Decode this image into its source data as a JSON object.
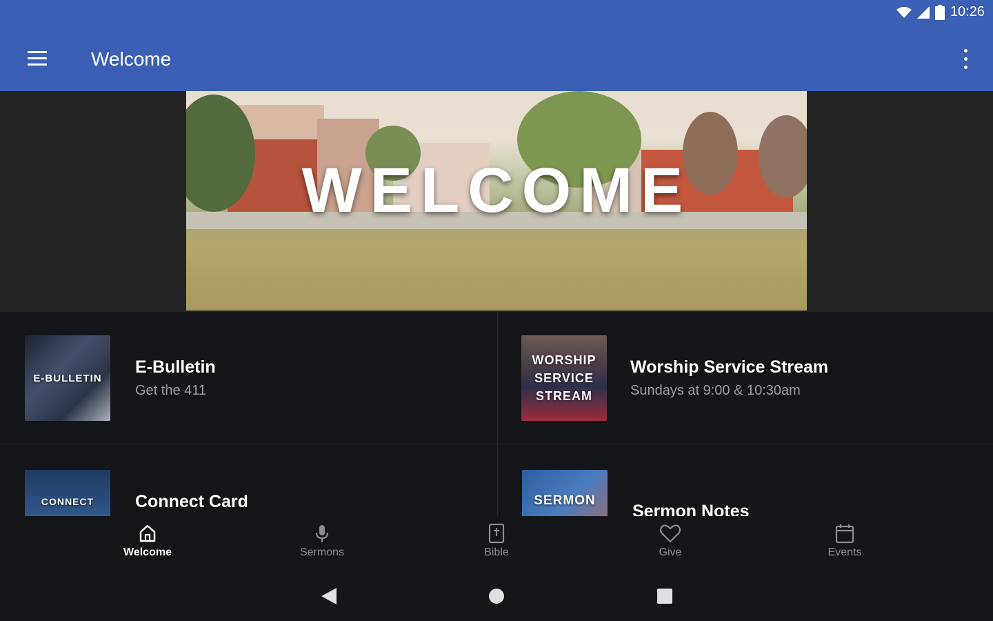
{
  "status_bar": {
    "time": "10:26",
    "icons": [
      "wifi-icon",
      "signal-icon",
      "battery-icon"
    ]
  },
  "app_bar": {
    "title": "Welcome",
    "menu_icon": "menu-icon",
    "more_icon": "more-vert-icon"
  },
  "hero": {
    "text": "WELCOME"
  },
  "tiles": [
    {
      "thumb_label": "E-BULLETIN",
      "title": "E-Bulletin",
      "subtitle": "Get the 411"
    },
    {
      "thumb_label": "WORSHIP SERVICE STREAM",
      "title": "Worship Service Stream",
      "subtitle": "Sundays at 9:00 & 10:30am"
    },
    {
      "thumb_label": "CONNECT",
      "title": "Connect Card",
      "subtitle": ""
    },
    {
      "thumb_label": "SERMON",
      "title": "Sermon Notes",
      "subtitle": ""
    }
  ],
  "bottom_nav": [
    {
      "label": "Welcome",
      "icon": "home-icon",
      "active": true
    },
    {
      "label": "Sermons",
      "icon": "microphone-icon",
      "active": false
    },
    {
      "label": "Bible",
      "icon": "bible-icon",
      "active": false
    },
    {
      "label": "Give",
      "icon": "heart-icon",
      "active": false
    },
    {
      "label": "Events",
      "icon": "calendar-icon",
      "active": false
    }
  ],
  "system_nav": [
    "back-icon",
    "home-circle-icon",
    "recents-icon"
  ],
  "colors": {
    "primary": "#3a5fb4",
    "background": "#141518",
    "active_nav": "#ffffff",
    "inactive_nav": "#8a8d92"
  }
}
